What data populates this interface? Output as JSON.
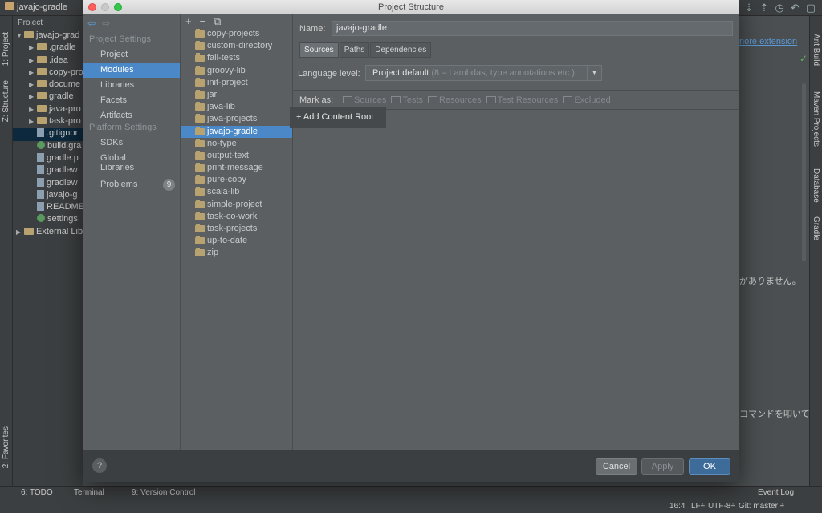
{
  "ide": {
    "project_crumb": "javajo-gradle",
    "left_tabs": {
      "project": "1: Project",
      "structure": "Z: Structure",
      "favorites": "2: Favorites"
    },
    "right_tabs": {
      "ant": "Ant Build",
      "maven": "Maven Projects",
      "database": "Database",
      "gradle": "Gradle"
    },
    "project_panel_header": "Project",
    "tree": [
      {
        "label": "javajo-grad",
        "kind": "folder",
        "arrow": "▼",
        "indent": 0
      },
      {
        "label": ".gradle",
        "kind": "folder",
        "arrow": "▶",
        "indent": 1
      },
      {
        "label": ".idea",
        "kind": "folder",
        "arrow": "▶",
        "indent": 1
      },
      {
        "label": "copy-pro",
        "kind": "folder",
        "arrow": "▶",
        "indent": 1
      },
      {
        "label": "docume",
        "kind": "folder",
        "arrow": "▶",
        "indent": 1
      },
      {
        "label": "gradle",
        "kind": "folder",
        "arrow": "▶",
        "indent": 1
      },
      {
        "label": "java-pro",
        "kind": "folder",
        "arrow": "▶",
        "indent": 1
      },
      {
        "label": "task-pro",
        "kind": "folder",
        "arrow": "▶",
        "indent": 1
      },
      {
        "label": ".gitignor",
        "kind": "file",
        "arrow": "",
        "indent": 1,
        "selected": true
      },
      {
        "label": "build.gra",
        "kind": "gradle",
        "arrow": "",
        "indent": 1
      },
      {
        "label": "gradle.p",
        "kind": "file",
        "arrow": "",
        "indent": 1
      },
      {
        "label": "gradlew",
        "kind": "file",
        "arrow": "",
        "indent": 1
      },
      {
        "label": "gradlew",
        "kind": "file",
        "arrow": "",
        "indent": 1
      },
      {
        "label": "javajo-g",
        "kind": "file",
        "arrow": "",
        "indent": 1
      },
      {
        "label": "README",
        "kind": "file",
        "arrow": "",
        "indent": 1
      },
      {
        "label": "settings.",
        "kind": "gradle",
        "arrow": "",
        "indent": 1
      },
      {
        "label": "External Lib",
        "kind": "lib",
        "arrow": "▶",
        "indent": 0
      }
    ],
    "editor_link": "nore extension",
    "editor_jp1": "がありません。",
    "editor_jp2": "コマンドを叩いてき",
    "bottom_tabs": {
      "todo": "6: TODO",
      "terminal": "Terminal",
      "vcs": "9: Version Control",
      "event_log": "Event Log"
    },
    "status": {
      "position": "16:4",
      "line_sep": "LF÷",
      "encoding": "UTF-8÷",
      "git": "Git: master ÷"
    }
  },
  "dialog": {
    "title": "Project Structure",
    "nav": {
      "project_settings": "Project Settings",
      "items_ps": [
        "Project",
        "Modules",
        "Libraries",
        "Facets",
        "Artifacts"
      ],
      "platform_settings": "Platform Settings",
      "items_pl": [
        "SDKs",
        "Global Libraries"
      ],
      "problems": "Problems",
      "problems_count": "9",
      "active": "Modules"
    },
    "modules": [
      "copy-projects",
      "custom-directory",
      "fail-tests",
      "groovy-lib",
      "init-project",
      "jar",
      "java-lib",
      "java-projects",
      "javajo-gradle",
      "no-type",
      "output-text",
      "print-message",
      "pure-copy",
      "scala-lib",
      "simple-project",
      "task-co-work",
      "task-projects",
      "up-to-date",
      "zip"
    ],
    "active_module": "javajo-gradle",
    "content": {
      "name_label": "Name:",
      "name_value": "javajo-gradle",
      "tabs": [
        "Sources",
        "Paths",
        "Dependencies"
      ],
      "active_tab": "Sources",
      "language_label": "Language level:",
      "language_value": "Project default",
      "language_hint": "(8 – Lambdas, type annotations etc.)",
      "mark_label": "Mark as:",
      "marks": [
        "Sources",
        "Tests",
        "Resources",
        "Test Resources",
        "Excluded"
      ],
      "add_content_root": "+ Add Content Root"
    },
    "footer": {
      "help": "?",
      "cancel": "Cancel",
      "apply": "Apply",
      "ok": "OK"
    }
  }
}
